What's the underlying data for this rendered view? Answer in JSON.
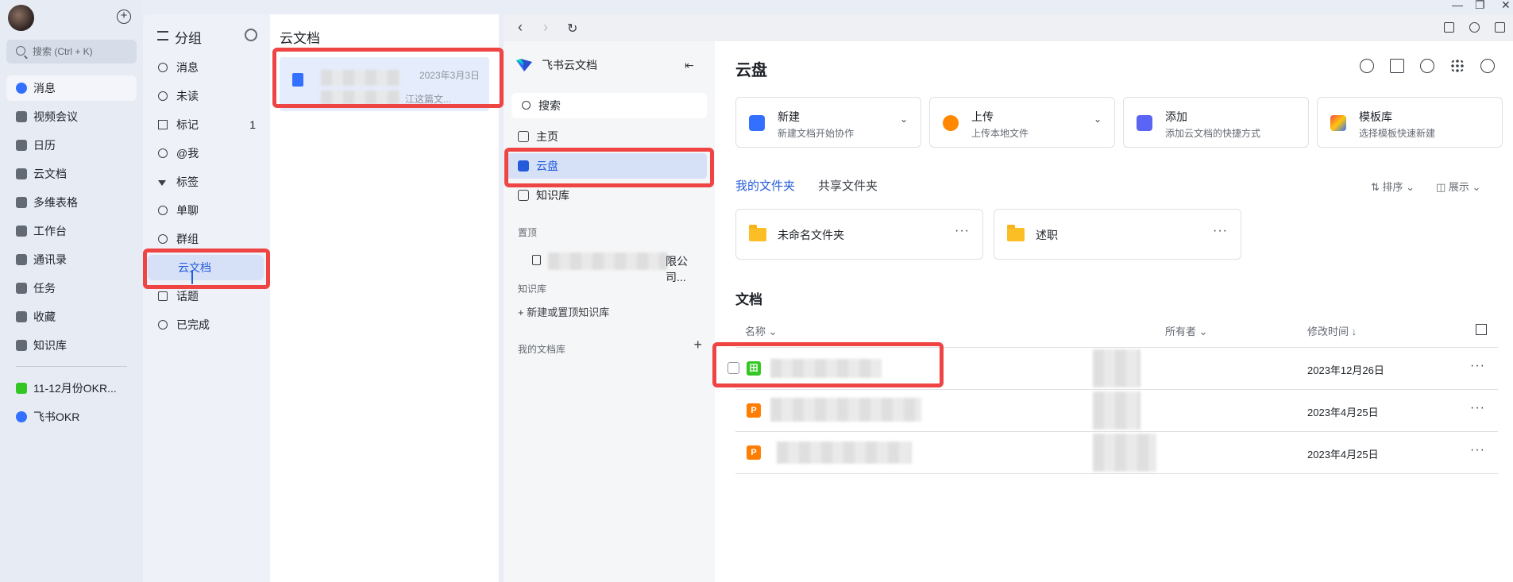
{
  "rail": {
    "search_placeholder": "搜索 (Ctrl + K)",
    "items": [
      {
        "label": "消息",
        "icon": "message-icon"
      },
      {
        "label": "视频会议",
        "icon": "video-icon"
      },
      {
        "label": "日历",
        "icon": "calendar-icon"
      },
      {
        "label": "云文档",
        "icon": "doc-icon"
      },
      {
        "label": "多维表格",
        "icon": "table-icon"
      },
      {
        "label": "工作台",
        "icon": "apps-icon"
      },
      {
        "label": "通讯录",
        "icon": "contacts-icon"
      },
      {
        "label": "任务",
        "icon": "task-icon"
      },
      {
        "label": "收藏",
        "icon": "star-icon"
      },
      {
        "label": "知识库",
        "icon": "wiki-icon"
      }
    ],
    "pinned": [
      {
        "label": "11-12月份OKR...",
        "color": "#34c724"
      },
      {
        "label": "飞书OKR",
        "color": "#3370ff"
      }
    ]
  },
  "groups": {
    "title": "分组",
    "items": [
      {
        "label": "消息",
        "count": ""
      },
      {
        "label": "未读",
        "count": ""
      },
      {
        "label": "标记",
        "count": "1"
      },
      {
        "label": "@我",
        "count": ""
      },
      {
        "label": "标签",
        "count": ""
      },
      {
        "label": "单聊",
        "count": ""
      },
      {
        "label": "群组",
        "count": ""
      },
      {
        "label": "云文档",
        "count": ""
      },
      {
        "label": "话题",
        "count": ""
      },
      {
        "label": "已完成",
        "count": ""
      }
    ]
  },
  "doclist": {
    "title": "云文档",
    "card": {
      "date": "2023年3月3日",
      "sub": "江这篇文..."
    }
  },
  "sidenav": {
    "brand": "飞书云文档",
    "search": "搜索",
    "home": "主页",
    "drive": "云盘",
    "wiki": "知识库",
    "pinned_label": "置顶",
    "pinned_item": "限公司...",
    "wiki_label": "知识库",
    "new_wiki": "新建或置顶知识库",
    "mylib_label": "我的文档库"
  },
  "main": {
    "title": "云盘",
    "actions": [
      {
        "title": "新建",
        "sub": "新建文档开始协作",
        "color": "#3370ff"
      },
      {
        "title": "上传",
        "sub": "上传本地文件",
        "color": "#ff8800"
      },
      {
        "title": "添加",
        "sub": "添加云文档的快捷方式",
        "color": "#5b65f5"
      },
      {
        "title": "模板库",
        "sub": "选择模板快速新建",
        "color": "#f54a45"
      }
    ],
    "tabs": [
      "我的文件夹",
      "共享文件夹"
    ],
    "sort_label": "排序",
    "view_label": "展示",
    "folders": [
      "未命名文件夹",
      "述职"
    ],
    "docs_title": "文档",
    "headers": {
      "name": "名称",
      "owner": "所有者",
      "modified": "修改时间 ↓"
    },
    "rows": [
      {
        "date": "2023年12月26日",
        "icon": "sheet-icon",
        "color": "#34c724",
        "glyph": "田"
      },
      {
        "date": "2023年4月25日",
        "icon": "ppt-icon",
        "color": "#ff7d00",
        "glyph": "P"
      },
      {
        "date": "2023年4月25日",
        "icon": "ppt-icon",
        "color": "#ff7d00",
        "glyph": "P"
      }
    ]
  }
}
